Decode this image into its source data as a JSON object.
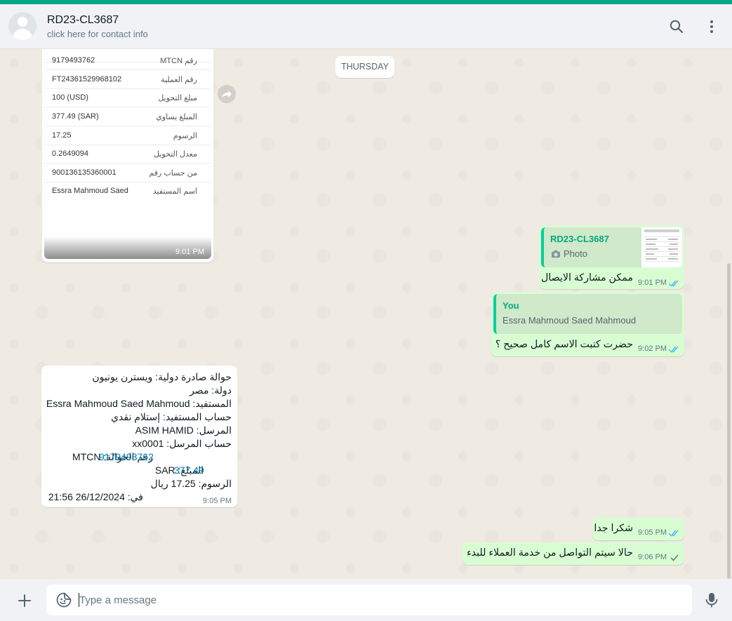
{
  "header": {
    "contact_name": "RD23-CL3687",
    "contact_subtitle": "click here for contact info"
  },
  "chat": {
    "day_label": "THURSDAY",
    "receipt_image": {
      "time": "9:01 PM",
      "rows": [
        {
          "label": "",
          "value": ""
        },
        {
          "label": "رقم MTCN",
          "value": "9179493762"
        },
        {
          "label": "رقم العملية",
          "value": "FT24361529968102"
        },
        {
          "label": "مبلغ التحويل",
          "value": "100 (USD)"
        },
        {
          "label": "المبلغ يساوي",
          "value": "377.49 (SAR)"
        },
        {
          "label": "الرسوم",
          "value": "17.25"
        },
        {
          "label": "معدل التحويل",
          "value": "0.2649094"
        },
        {
          "label": "من حساب رقم",
          "value": "900136135360001"
        },
        {
          "label": "اسم المستفيد",
          "value": "Essra Mahmoud Saed"
        }
      ]
    },
    "out_msg_1": {
      "quote_author": "RD23-CL3687",
      "quote_text": "Photo",
      "text": "ممكن مشاركة الايصال",
      "time": "9:01 PM"
    },
    "out_msg_2": {
      "quote_author": "You",
      "quote_text": "Essra Mahmoud Saed Mahmoud",
      "text": "حضرت كتبت الاسم كامل صحيح ؟",
      "time": "9:02 PM"
    },
    "in_msg": {
      "lines": [
        "حوالة صادرة دولية: ويسترن يونيون",
        "دولة: مصر",
        "المستفيد: Essra Mahmoud Saed Mahmoud",
        "حساب المستفيد: إستلام نقدي",
        "المرسل: ASIM HAMID",
        "حساب المرسل: xx0001",
        "رقم الحوالة: MTCN",
        "9179493762",
        "المبلغ: SAR",
        "377.49",
        "الرسوم: 17.25 ريال",
        "في: 26/12/2024 21:56"
      ],
      "time": "9:05 PM"
    },
    "out_msg_3": {
      "text": "شكرا جدا",
      "time": "9:05 PM"
    },
    "out_msg_4": {
      "text": "حالا سيتم التواصل من خدمة العملاء للبدء",
      "time": "9:06 PM"
    },
    "tick_read_color": "#53bdeb",
    "tick_sent_color": "#667781"
  },
  "composer": {
    "placeholder": "Type a message"
  },
  "colors": {
    "accent": "#00a884",
    "outgoing_bubble": "#d9fdd3",
    "incoming_bubble": "#ffffff",
    "background": "#efeae2"
  }
}
